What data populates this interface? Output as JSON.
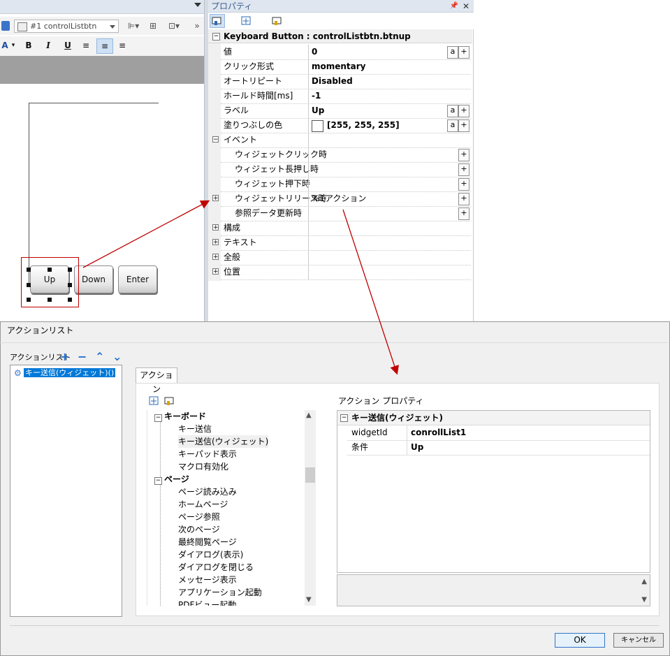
{
  "editor": {
    "widget_combo": "#1 controlListbtn",
    "format_buttons": [
      "A",
      "B",
      "I",
      "U"
    ],
    "buttons": [
      "Up",
      "Down",
      "Enter"
    ]
  },
  "properties": {
    "panel_title": "プロパティ",
    "object_header": "Keyboard Button : controlListbtn.btnup",
    "rows": [
      {
        "name": "値",
        "value": "0"
      },
      {
        "name": "クリック形式",
        "value": "momentary"
      },
      {
        "name": "オートリピート",
        "value": "Disabled"
      },
      {
        "name": "ホールド時間[ms]",
        "value": "-1"
      },
      {
        "name": "ラベル",
        "value": "Up"
      },
      {
        "name": "塗りつぶしの色",
        "value": "[255, 255, 255]"
      }
    ],
    "event_group": "イベント",
    "events": [
      {
        "name": "ウィジェットクリック時",
        "value": ""
      },
      {
        "name": "ウィジェット長押し時",
        "value": ""
      },
      {
        "name": "ウィジェット押下時",
        "value": ""
      },
      {
        "name": "ウィジェットリリース時",
        "value": "%1アクション"
      },
      {
        "name": "参照データ更新時",
        "value": ""
      }
    ],
    "groups": [
      "構成",
      "テキスト",
      "全般",
      "位置"
    ],
    "btn_a": "a",
    "btn_plus": "+",
    "colors": {
      "accent": "#c00000",
      "selection": "#0078d7",
      "title": "#3a5c8c"
    }
  },
  "dialog": {
    "title": "アクションリスト",
    "list_label": "アクションリスト",
    "list_tools": [
      "+",
      "−",
      "⌃",
      "⌄"
    ],
    "list_items": [
      "キー送信(ウィジェット)()"
    ],
    "tab": "アクション",
    "tree": {
      "group1": "キーボード",
      "group1_items": [
        "キー送信",
        "キー送信(ウィジェット)",
        "キーパッド表示",
        "マクロ有効化"
      ],
      "group2": "ページ",
      "group2_items": [
        "ページ読み込み",
        "ホームページ",
        "ページ参照",
        "次のページ",
        "最終閲覧ページ",
        "ダイアログ(表示)",
        "ダイアログを閉じる",
        "メッセージ表示",
        "アプリケーション起動",
        "PDFビュー起動"
      ]
    },
    "props_label": "アクション プロパティ",
    "props_header": "キー送信(ウィジェット)",
    "props": [
      {
        "key": "widgetId",
        "value": "conrollList1"
      },
      {
        "key": "条件",
        "value": "Up"
      }
    ],
    "ok": "OK",
    "cancel": "キャンセル"
  }
}
